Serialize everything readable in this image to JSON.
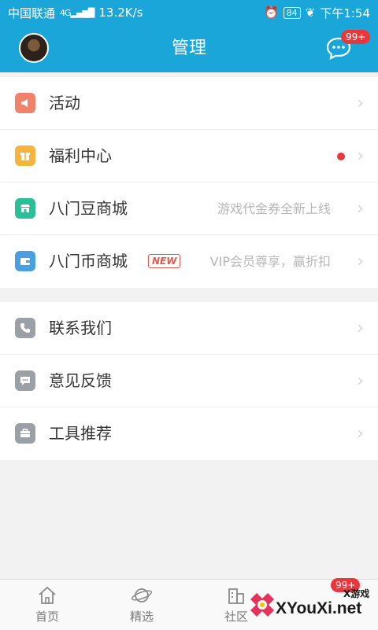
{
  "status_bar": {
    "carrier": "中国联通",
    "network": "4G",
    "speed": "13.2K/s",
    "battery": "84",
    "time": "下午1:54"
  },
  "header": {
    "title": "管理",
    "message_badge": "99+"
  },
  "menu_group_1": [
    {
      "label": "活动",
      "icon": "megaphone-icon",
      "icon_color": "#f0826a"
    },
    {
      "label": "福利中心",
      "icon": "gift-icon",
      "icon_color": "#f5b33f",
      "has_dot": true
    },
    {
      "label": "八门豆商城",
      "icon": "store-icon",
      "icon_color": "#2bbf97",
      "subtitle": "游戏代金券全新上线"
    },
    {
      "label": "八门币商城",
      "icon": "wallet-icon",
      "icon_color": "#4a9fe0",
      "tag": "NEW",
      "subtitle": "VIP会员尊享，赢折扣"
    }
  ],
  "menu_group_2": [
    {
      "label": "联系我们",
      "icon": "phone-icon",
      "icon_color": "#9aa0a6"
    },
    {
      "label": "意见反馈",
      "icon": "feedback-icon",
      "icon_color": "#9aa0a6"
    },
    {
      "label": "工具推荐",
      "icon": "toolbox-icon",
      "icon_color": "#9aa0a6"
    }
  ],
  "tab_bar": {
    "tabs": [
      {
        "label": "首页",
        "icon": "home-icon"
      },
      {
        "label": "精选",
        "icon": "planet-icon"
      },
      {
        "label": "社区",
        "icon": "building-icon"
      }
    ],
    "badge": "99+"
  },
  "watermark": {
    "top_text": "X游戏",
    "main_text": "XYouXi.net"
  },
  "colors": {
    "primary": "#1aa6d9",
    "badge_red": "#e8383d"
  }
}
